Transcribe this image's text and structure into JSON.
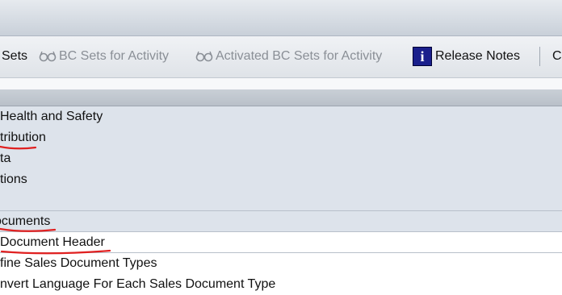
{
  "toolbar": {
    "items": [
      {
        "label": "Sets",
        "enabled": true
      },
      {
        "label": "BC Sets for Activity",
        "enabled": false,
        "icon": "glasses-icon"
      },
      {
        "label": "Activated BC Sets for Activity",
        "enabled": false,
        "icon": "glasses-icon"
      },
      {
        "label": "Release Notes",
        "enabled": true,
        "icon": "info-icon"
      },
      {
        "label": "C",
        "enabled": true
      }
    ],
    "info_glyph": "i"
  },
  "tree": {
    "rows": [
      {
        "label": "Health and Safety"
      },
      {
        "label": "tribution",
        "underlined": true
      },
      {
        "label": "ta"
      },
      {
        "label": "tions"
      },
      {
        "label": ""
      },
      {
        "label": "ocuments",
        "underlined": true
      },
      {
        "label": "Document Header",
        "underlined": true
      },
      {
        "label": "fine Sales Document Types"
      },
      {
        "label": "nvert Language For Each Sales Document Type"
      }
    ]
  },
  "colors": {
    "annotation": "#e02020",
    "row_blue": "#dde3eb",
    "info_icon_bg": "#1a1f8c"
  }
}
